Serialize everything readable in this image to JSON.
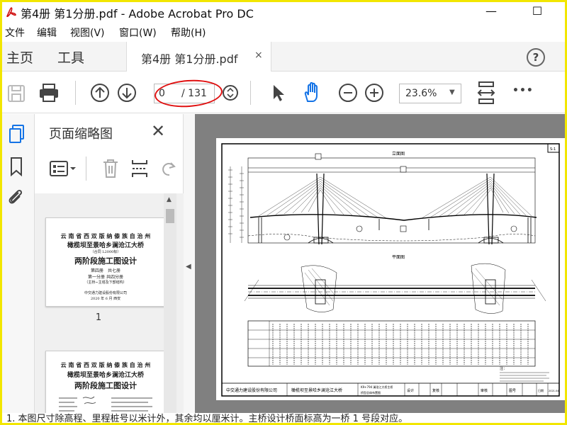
{
  "window": {
    "title": "第4册 第1分册.pdf - Adobe Acrobat Pro DC",
    "minimize_glyph": "—",
    "maximize_glyph": "☐"
  },
  "menu": [
    "文件",
    "编辑",
    "视图(V)",
    "窗口(W)",
    "帮助(H)"
  ],
  "tabs": {
    "home": "主页",
    "tools": "工具",
    "document": "第4册 第1分册.pdf",
    "close_glyph": "×",
    "help_glyph": "?"
  },
  "toolbar": {
    "current_page": "0",
    "total_pages": "/ 131",
    "zoom": "23.6%",
    "more_glyph": "•••"
  },
  "panel": {
    "title": "页面缩略图",
    "close_glyph": "✕",
    "thumbnails": [
      {
        "page_label": "1",
        "lines": [
          "云 南 省 西 双 版 纳 傣 族 自 治 州",
          "橄榄坝至景哈乡澜沧江大桥",
          "（合同 L2000标）",
          "两阶段施工图设计",
          "第四册　共七册",
          "第一分册 共四分册",
          "（主桥~主塔及下部结构）",
          "中交通力建设股份有限公司",
          "2020 年 6 月 西安"
        ]
      },
      {
        "page_label": "",
        "lines": [
          "云 南 省 西 双 版 纳 傣 族 自 治 州",
          "橄榄坝至景哈乡澜沧江大桥",
          "两阶段施工图设计"
        ]
      }
    ]
  },
  "drawing": {
    "top_label": "立面图",
    "bottom_label": "平面图",
    "company": "中交通力建设股份有限公司",
    "project": "橄榄坝至景哈乡澜沧江大桥",
    "sheet_title_1": "K9+794 澜沧江大桥主桥",
    "sheet_title_2": "桥型总体布置图",
    "design_label": "设计",
    "review_label": "复核",
    "approve_label": "审核",
    "figure_no_label": "图号",
    "date_label": "日期",
    "date_value": "2021.04",
    "sheet_no": "S-1",
    "notes_label": "注："
  },
  "bottom_text": "1. 本图尺寸除高程、里程桩号以米计外，其余均以厘米计。主桥设计桥面标高为一桥 1 号段对应。"
}
